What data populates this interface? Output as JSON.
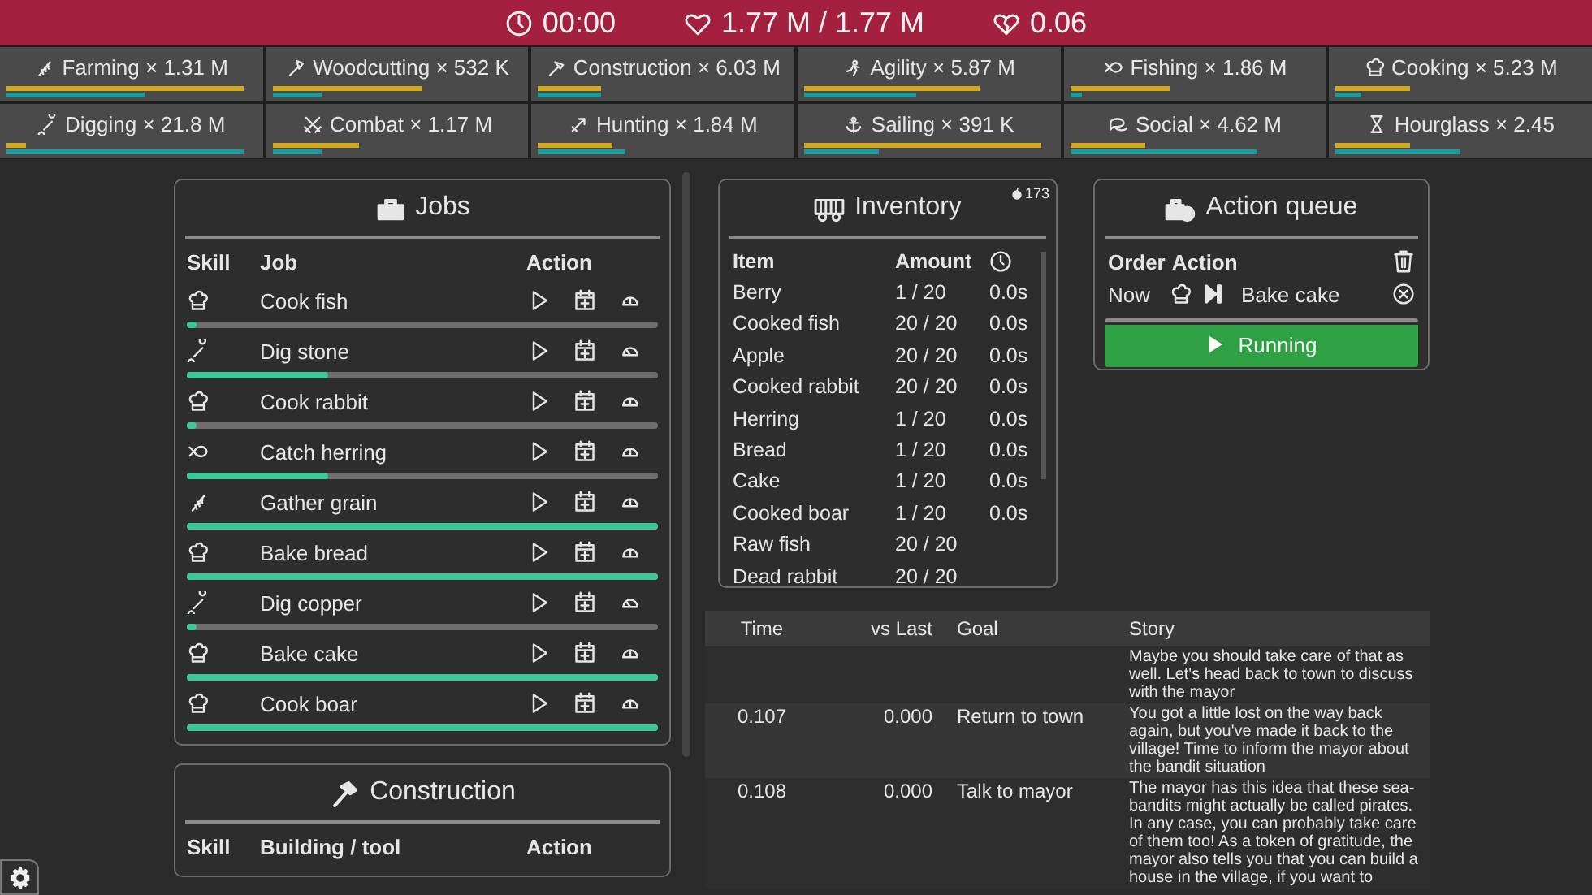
{
  "top_bar": {
    "time": "00:00",
    "health": "1.77 M / 1.77 M",
    "rate": "0.06"
  },
  "skills": [
    {
      "kind": "farming",
      "label": "Farming × 1.31 M",
      "progress": {
        "level": 0.95
      },
      "xp": {
        "level": 0.55
      }
    },
    {
      "kind": "woodcutting",
      "label": "Woodcutting × 532 K",
      "progress": {
        "level": 0.6
      },
      "xp": {
        "level": 0.2
      }
    },
    {
      "kind": "construction",
      "label": "Construction × 6.03 M",
      "progress": {
        "level": 0.25
      },
      "xp": {
        "level": 0.25
      }
    },
    {
      "kind": "agility",
      "label": "Agility × 5.87 M",
      "progress": {
        "level": 0.7
      },
      "xp": {
        "level": 0.45
      }
    },
    {
      "kind": "fishing",
      "label": "Fishing × 1.86 M",
      "progress": {
        "level": 0.4
      },
      "xp": {
        "level": 0.05
      }
    },
    {
      "kind": "cooking",
      "label": "Cooking × 5.23 M",
      "progress": {
        "level": 0.3
      },
      "xp": {
        "level": 0.1
      }
    },
    {
      "kind": "digging",
      "label": "Digging × 21.8 M",
      "progress": {
        "level": 0.08
      },
      "xp": {
        "level": 0.95
      }
    },
    {
      "kind": "combat",
      "label": "Combat × 1.17 M",
      "progress": {
        "level": 0.35
      },
      "xp": {
        "level": 0.2
      }
    },
    {
      "kind": "hunting",
      "label": "Hunting × 1.84 M",
      "progress": {
        "level": 0.3
      },
      "xp": {
        "level": 0.35
      }
    },
    {
      "kind": "sailing",
      "label": "Sailing × 391 K",
      "progress": {
        "level": 0.95
      },
      "xp": {
        "level": 0.3
      }
    },
    {
      "kind": "social",
      "label": "Social × 4.62 M",
      "progress": {
        "level": 0.3
      },
      "xp": {
        "level": 0.75
      }
    },
    {
      "kind": "hourglass",
      "label": "Hourglass × 2.45",
      "progress": {
        "level": 0.3
      },
      "xp": {
        "level": 0.5
      }
    }
  ],
  "jobs": {
    "title": "Jobs",
    "columns": [
      "Skill",
      "Job",
      "Action"
    ],
    "rows": [
      {
        "kind": "cooking",
        "job": "Cook fish",
        "level": 0.02
      },
      {
        "kind": "digging",
        "job": "Dig stone",
        "level": 0.3
      },
      {
        "kind": "cooking",
        "job": "Cook rabbit",
        "level": 0.02
      },
      {
        "kind": "fishing",
        "job": "Catch herring",
        "level": 0.3
      },
      {
        "kind": "farming",
        "job": "Gather grain",
        "level": 1
      },
      {
        "kind": "cooking",
        "job": "Bake bread",
        "level": 1
      },
      {
        "kind": "digging",
        "job": "Dig copper",
        "level": 0.02
      },
      {
        "kind": "cooking",
        "job": "Bake cake",
        "level": 1
      },
      {
        "kind": "cooking",
        "job": "Cook boar",
        "level": 1
      }
    ]
  },
  "construction": {
    "title": "Construction",
    "columns": [
      "Skill",
      "Building / tool",
      "Action"
    ]
  },
  "inventory": {
    "title": "Inventory",
    "count": "173",
    "columns": [
      "Item",
      "Amount"
    ],
    "rows": [
      {
        "item": "Berry",
        "amount": "1 / 20",
        "time": "0.0s"
      },
      {
        "item": "Cooked fish",
        "amount": "20 / 20",
        "time": "0.0s"
      },
      {
        "item": "Apple",
        "amount": "20 / 20",
        "time": "0.0s"
      },
      {
        "item": "Cooked rabbit",
        "amount": "20 / 20",
        "time": "0.0s"
      },
      {
        "item": "Herring",
        "amount": "1 / 20",
        "time": "0.0s"
      },
      {
        "item": "Bread",
        "amount": "1 / 20",
        "time": "0.0s"
      },
      {
        "item": "Cake",
        "amount": "1 / 20",
        "time": "0.0s"
      },
      {
        "item": "Cooked boar",
        "amount": "1 / 20",
        "time": "0.0s"
      },
      {
        "item": "Raw fish",
        "amount": "20 / 20"
      },
      {
        "item": "Dead rabbit",
        "amount": "20 / 20"
      }
    ]
  },
  "action_queue": {
    "title": "Action queue",
    "columns": [
      "Order",
      "Action"
    ],
    "rows": [
      {
        "order": "Now",
        "kind": "cooking",
        "action": "Bake cake"
      }
    ],
    "button": "Running"
  },
  "story": {
    "columns": [
      "Time",
      "vs Last",
      "Goal",
      "Story"
    ],
    "rows": [
      {
        "story": "Maybe you should take care of that as well. Let's head back to town to discuss with the mayor"
      },
      {
        "time": "0.107",
        "vs_last": "0.000",
        "goal": "Return to town",
        "story": "You got a little lost on the way back again, but you've made it back to the village! Time to inform the mayor about the bandit situation"
      },
      {
        "time": "0.108",
        "vs_last": "0.000",
        "goal": "Talk to mayor",
        "story": "The mayor has this idea that these sea-bandits might actually be called pirates. In any case, you can probably take care of them too! As a token of gratitude, the mayor also tells you that you can build a house in the village, if you want to"
      }
    ]
  }
}
